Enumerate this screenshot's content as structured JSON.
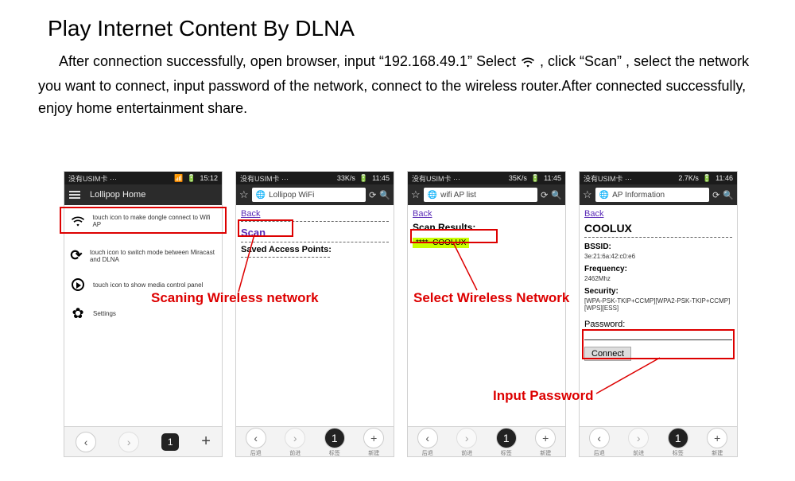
{
  "title": "Play Internet Content By DLNA",
  "intro_parts": {
    "a": "After connection successfully, open browser, input “192.168.49.1” Select",
    "b": ", click “Scan” ,",
    "c": "select the network you want to connect, input password of the network, connect to the wireless router.After connected successfully, enjoy home entertainment share."
  },
  "status": {
    "carrier": "没有USIM卡 ···",
    "speed_a": "33K/s",
    "speed_b": "35K/s",
    "speed_c": "2.7K/s",
    "time_a": "15:12",
    "time_b": "11:45",
    "time_c": "11:45",
    "time_d": "11:46"
  },
  "screen1": {
    "header": "Lollipop Home",
    "row1": "touch icon to make dongle connect to Wifi AP",
    "row2": "touch icon to switch mode between Miracast and DLNA",
    "row3": "touch icon to show media control panel",
    "row4": "Settings"
  },
  "screen2": {
    "url": "Lollipop WiFi",
    "back": "Back",
    "scan": "Scan",
    "saved": "Saved Access Points:"
  },
  "screen3": {
    "url": "wifi AP list",
    "back": "Back",
    "results": "Scan Results:",
    "net_strength": "****",
    "net_name": "COOLUX"
  },
  "screen4": {
    "url": "AP Information",
    "back": "Back",
    "name": "COOLUX",
    "bssid_k": "BSSID:",
    "bssid_v": "3e:21:6a:42:c0:e6",
    "freq_k": "Frequency:",
    "freq_v": "2462Mhz",
    "sec_k": "Security:",
    "sec_v": "[WPA-PSK-TKIP+CCMP][WPA2-PSK-TKIP+CCMP][WPS][ESS]",
    "pwd_k": "Password:",
    "connect": "Connect"
  },
  "bottom": {
    "badge": "1"
  },
  "anno": {
    "scan": "Scaning Wireless network",
    "select": "Select Wireless Network",
    "password": "Input Password"
  }
}
